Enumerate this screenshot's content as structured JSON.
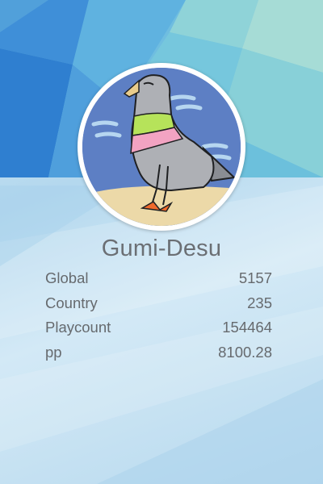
{
  "profile": {
    "username": "Gumi-Desu",
    "avatar_icon": "pigeon-avatar",
    "stats": [
      {
        "label": "Global",
        "value": "5157"
      },
      {
        "label": "Country",
        "value": "235"
      },
      {
        "label": "Playcount",
        "value": "154464"
      },
      {
        "label": "pp",
        "value": "8100.28"
      }
    ]
  },
  "colors": {
    "banner_dark_blue": "#2f7fd0",
    "banner_teal": "#7ecfd0",
    "card_background": "#c4e0f2",
    "text": "#666a6e"
  }
}
